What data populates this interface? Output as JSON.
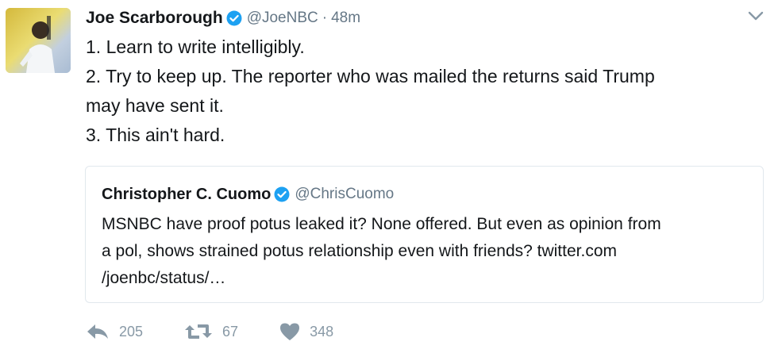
{
  "tweet": {
    "name": "Joe Scarborough",
    "handle": "@JoeNBC",
    "separator": "·",
    "time": "48m",
    "text_lines": [
      "1. Learn to write intelligibly.",
      "2. Try to keep up. The reporter who was mailed the returns said Trump",
      "may have sent it.",
      "3. This ain't hard."
    ]
  },
  "quoted_tweet": {
    "name": "Christopher C. Cuomo",
    "handle": "@ChrisCuomo",
    "text_lines": [
      "MSNBC have proof potus leaked it? None offered. But even as opinion from",
      "a pol, shows strained potus relationship even with friends? twitter.com",
      "/joenbc/status/…"
    ]
  },
  "actions": {
    "reply_count": "205",
    "retweet_count": "67",
    "like_count": "348"
  },
  "icons": {
    "verified": "verified-badge-icon",
    "caret": "chevron-down-icon",
    "reply": "reply-icon",
    "retweet": "retweet-icon",
    "like": "heart-icon"
  },
  "colors": {
    "verified_blue": "#1da1f2",
    "secondary_text": "#657786",
    "action_gray": "#8899a6",
    "border": "#e1e8ed"
  }
}
